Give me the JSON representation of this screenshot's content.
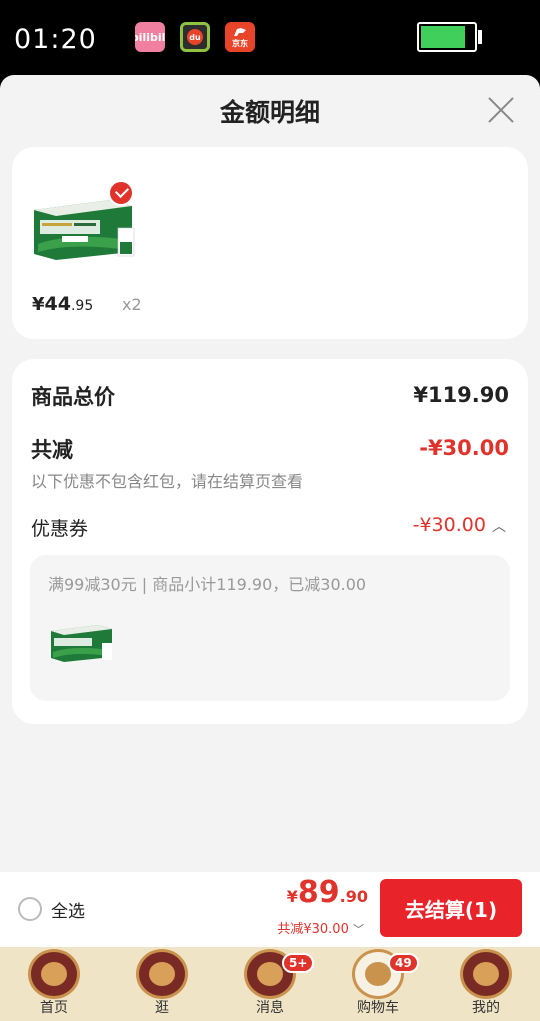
{
  "status_bar": {
    "time": "01:20",
    "apps": [
      {
        "name": "bilibili-icon",
        "label": "bilibili"
      },
      {
        "name": "du-app-icon",
        "label": "du"
      },
      {
        "name": "jd-app-icon",
        "label": "京东"
      }
    ],
    "battery_level": 0.85
  },
  "sheet": {
    "title": "金额明细"
  },
  "product": {
    "price_symbol": "¥",
    "price_int": "44",
    "price_dec": ".95",
    "quantity": "x2",
    "selected": true
  },
  "summary": {
    "total_label": "商品总价",
    "total_value": "¥119.90",
    "reduction_label": "共减",
    "reduction_value": "-¥30.00",
    "note": "以下优惠不包含红包，请在结算页查看",
    "coupon_label": "优惠券",
    "coupon_value": "-¥30.00",
    "coupon_desc": "满99减30元 | 商品小计119.90，已减30.00"
  },
  "checkout": {
    "select_all_label": "全选",
    "total_symbol": "¥",
    "total_int": "89",
    "total_dec": ".90",
    "reduced_text": "共减¥30.00",
    "button_label": "去结算(1)"
  },
  "bottom_nav": {
    "items": [
      {
        "label": "首页",
        "badge": ""
      },
      {
        "label": "逛",
        "badge": ""
      },
      {
        "label": "消息",
        "badge": "5+"
      },
      {
        "label": "购物车",
        "badge": "49"
      },
      {
        "label": "我的",
        "badge": ""
      }
    ]
  },
  "colors": {
    "accent_red": "#e0332c",
    "checkout_red": "#e8232a",
    "nav_bg": "#f0e4c6"
  }
}
